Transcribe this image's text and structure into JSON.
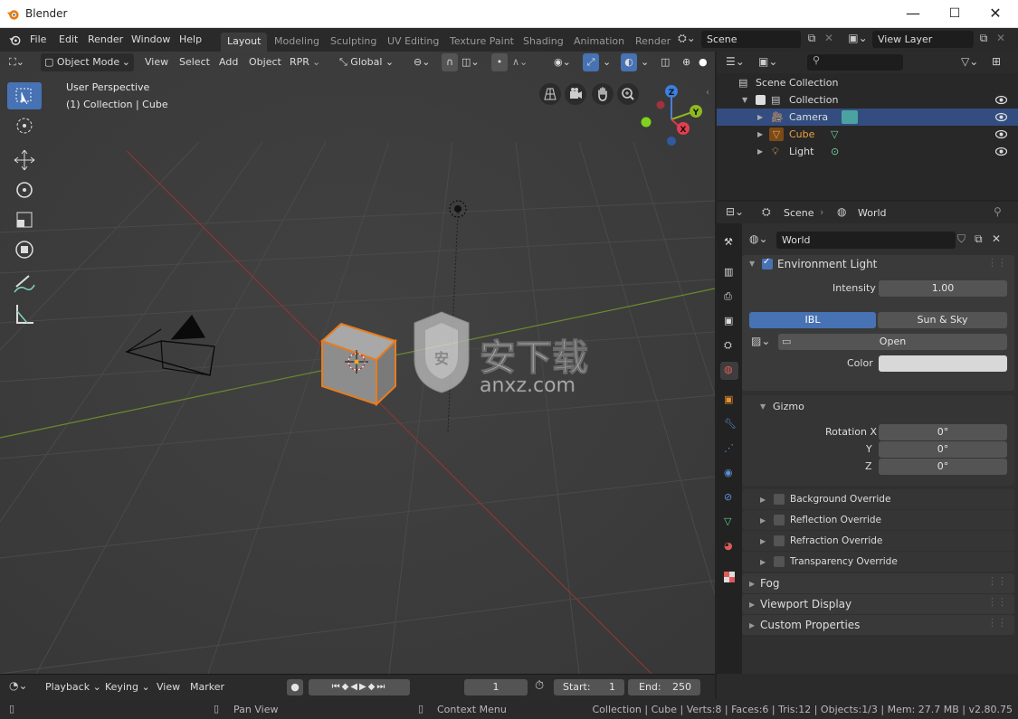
{
  "window": {
    "title": "Blender",
    "minimize": "—",
    "maximize": "☐",
    "close": "✕"
  },
  "menus": [
    "File",
    "Edit",
    "Render",
    "Window",
    "Help"
  ],
  "workspaces": [
    {
      "label": "Layout",
      "active": true
    },
    {
      "label": "Modeling",
      "active": false
    },
    {
      "label": "Sculpting",
      "active": false
    },
    {
      "label": "UV Editing",
      "active": false
    },
    {
      "label": "Texture Paint",
      "active": false
    },
    {
      "label": "Shading",
      "active": false
    },
    {
      "label": "Animation",
      "active": false
    },
    {
      "label": "Render",
      "active": false
    }
  ],
  "scene_field": "Scene",
  "view_layer_field": "View Layer",
  "viewport_header": {
    "mode": "Object Mode",
    "menus": [
      "View",
      "Select",
      "Add",
      "Object",
      "RPR"
    ],
    "transform_orientation": "Global"
  },
  "viewport": {
    "perspective_label": "User Perspective",
    "collection_label": "(1) Collection | Cube",
    "gizmo_axes": {
      "x": "X",
      "y": "Y",
      "z": "Z"
    },
    "accent_selected": "#e87c1e"
  },
  "outliner": {
    "search_placeholder": "",
    "rows": [
      {
        "label": "Scene Collection",
        "icon": "collection-icon",
        "visible_eye": false
      },
      {
        "label": "Collection",
        "icon": "collection-icon",
        "visible_eye": true
      },
      {
        "label": "Camera",
        "icon": "camera-icon",
        "visible_eye": true,
        "selected": true
      },
      {
        "label": "Cube",
        "icon": "mesh-icon",
        "visible_eye": true,
        "active": true
      },
      {
        "label": "Light",
        "icon": "light-icon",
        "visible_eye": true
      }
    ]
  },
  "properties": {
    "breadcrumb": [
      "Scene",
      "World"
    ],
    "world_name": "World",
    "env_light_label": "Environment Light",
    "intensity_label": "Intensity",
    "intensity_value": "1.00",
    "ibl_tab": "IBL",
    "sun_sky_tab": "Sun & Sky",
    "open_button": "Open",
    "color_label": "Color",
    "gizmo_label": "Gizmo",
    "rotation_labels": [
      "Rotation X",
      "Y",
      "Z"
    ],
    "rotation_values": [
      "0°",
      "0°",
      "0°"
    ],
    "overrides": [
      "Background Override",
      "Reflection Override",
      "Refraction Override",
      "Transparency Override"
    ],
    "sections": [
      "Fog",
      "Viewport Display",
      "Custom Properties"
    ]
  },
  "timeline": {
    "menus": [
      "Playback",
      "Keying",
      "View",
      "Marker"
    ],
    "current_frame": "1",
    "start_label": "Start:",
    "start_value": "1",
    "end_label": "End:",
    "end_value": "250"
  },
  "statusbar": {
    "pan_view": "Pan View",
    "context_menu": "Context Menu",
    "stats": "Collection | Cube | Verts:8 | Faces:6 | Tris:12 | Objects:1/3 | Mem: 27.7 MB | v2.80.75"
  },
  "watermark": {
    "text": "安下载",
    "sub": "anxz.com"
  }
}
